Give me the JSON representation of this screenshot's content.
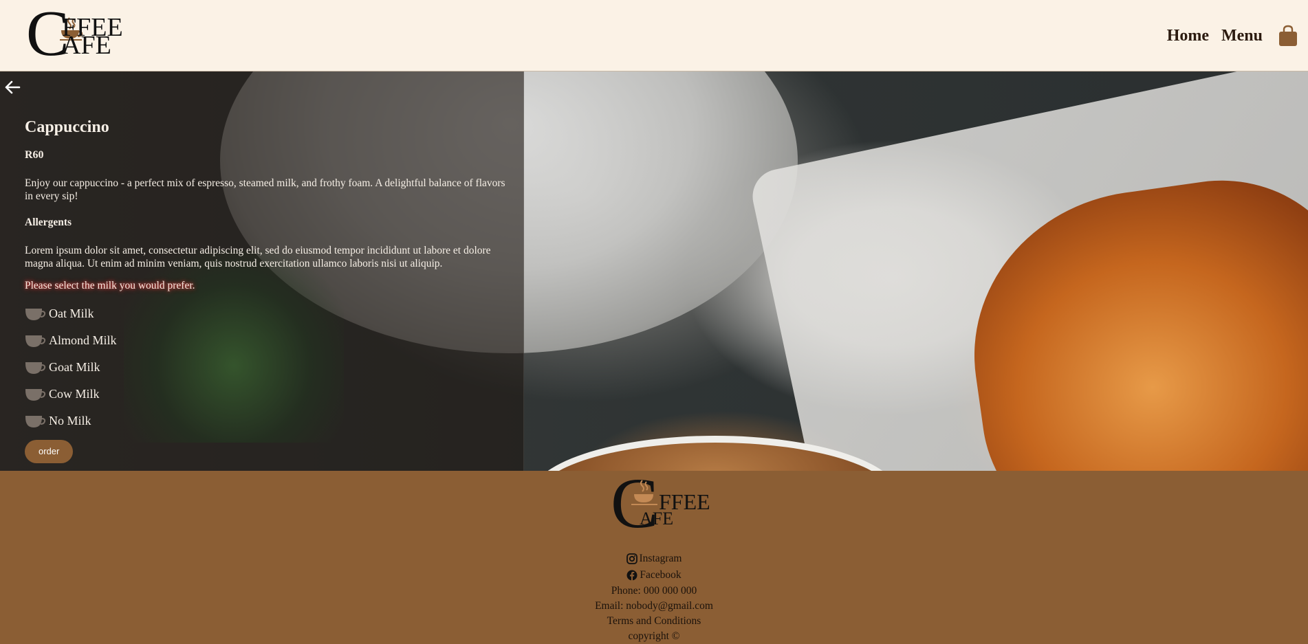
{
  "header": {
    "logo": {
      "big_letter": "C",
      "line1": "FFEE",
      "line2": "AFE"
    },
    "nav": {
      "home": "Home",
      "menu": "Menu"
    },
    "icons": {
      "cart": "shopping-bag-icon"
    },
    "colors": {
      "background": "#fbf2e6",
      "accent": "#8b5e34",
      "nav_text": "#2c1b10"
    }
  },
  "product": {
    "name": "Cappuccino",
    "price": "R60",
    "description": "Enjoy our cappuccino - a perfect mix of espresso, steamed milk, and frothy foam. A delightful balance of flavors in every sip!",
    "allergens_heading": "Allergents",
    "allergens_text": "Lorem ipsum dolor sit amet, consectetur adipiscing elit, sed do eiusmod tempor incididunt ut labore et dolore magna aliqua. Ut enim ad minim veniam, quis nostrud exercitation ullamco laboris nisi ut aliquip.",
    "milk_prompt": "Please select the milk you would prefer.",
    "milk_options": [
      "Oat Milk",
      "Almond Milk",
      "Goat Milk",
      "Cow Milk",
      "No Milk"
    ],
    "order_label": "order",
    "icons": {
      "back": "arrow-left-icon",
      "option": "mug-icon"
    }
  },
  "footer": {
    "logo": {
      "big_letter": "C",
      "line1": "FFEE",
      "line2": "AFE"
    },
    "instagram": "Instagram",
    "facebook": "Facebook",
    "phone": "Phone: 000 000 000",
    "email": "Email: nobody@gmail.com",
    "terms": "Terms and Conditions",
    "copyright": "copyright ©",
    "colors": {
      "background": "#8b5e34"
    }
  }
}
